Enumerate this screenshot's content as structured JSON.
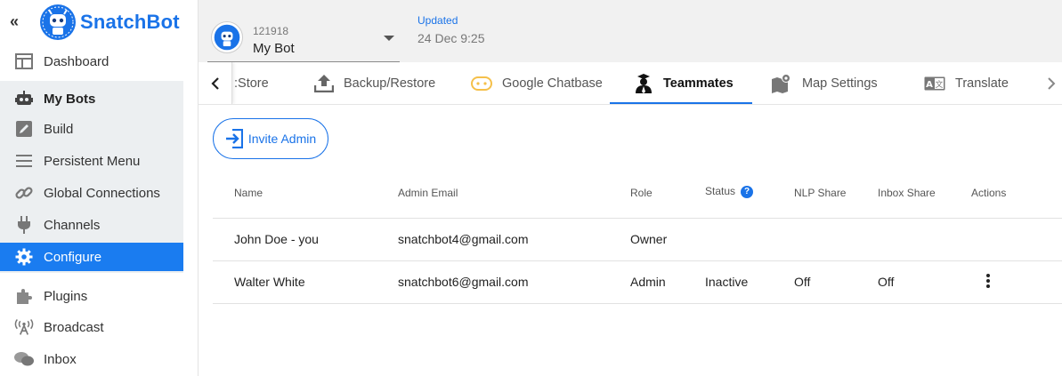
{
  "brand": {
    "name": "SnatchBot",
    "color": "#1a73e8"
  },
  "sidebar": {
    "collapse_glyph": "«",
    "items": [
      {
        "label": "Dashboard",
        "icon": "dashboard-icon"
      },
      {
        "label": "My Bots",
        "icon": "robot-icon"
      },
      {
        "label": "Build",
        "icon": "pencil-icon"
      },
      {
        "label": "Persistent Menu",
        "icon": "menu-icon"
      },
      {
        "label": "Global Connections",
        "icon": "link-icon"
      },
      {
        "label": "Channels",
        "icon": "plug-icon"
      },
      {
        "label": "Configure",
        "icon": "gear-icon"
      },
      {
        "label": "Plugins",
        "icon": "puzzle-icon"
      },
      {
        "label": "Broadcast",
        "icon": "broadcast-icon"
      },
      {
        "label": "Inbox",
        "icon": "chat-icon"
      }
    ],
    "active_color": "#1a7cf0"
  },
  "bot": {
    "id": "121918",
    "name": "My Bot"
  },
  "updated": {
    "label": "Updated",
    "value": "24 Dec 9:25"
  },
  "tabs": [
    {
      "label": "Store",
      "icon": "store-icon",
      "partial": true
    },
    {
      "label": "Backup/Restore",
      "icon": "upload-icon"
    },
    {
      "label": "Google Chatbase",
      "icon": "chatbase-icon"
    },
    {
      "label": "Teammates",
      "icon": "teammates-icon",
      "active": true
    },
    {
      "label": "Map Settings",
      "icon": "map-icon"
    },
    {
      "label": "Translate",
      "icon": "translate-icon"
    }
  ],
  "invite": {
    "label": "Invite Admin"
  },
  "table": {
    "headers": [
      "Name",
      "Admin Email",
      "Role",
      "Status",
      "NLP Share",
      "Inbox Share",
      "Actions"
    ],
    "rows": [
      {
        "name": "John Doe - you",
        "email": "snatchbot4@gmail.com",
        "role": "Owner",
        "status": "",
        "nlp": "",
        "inbox": "",
        "actions": false
      },
      {
        "name": "Walter White",
        "email": "snatchbot6@gmail.com",
        "role": "Admin",
        "status": "Inactive",
        "nlp": "Off",
        "inbox": "Off",
        "actions": true
      }
    ]
  }
}
